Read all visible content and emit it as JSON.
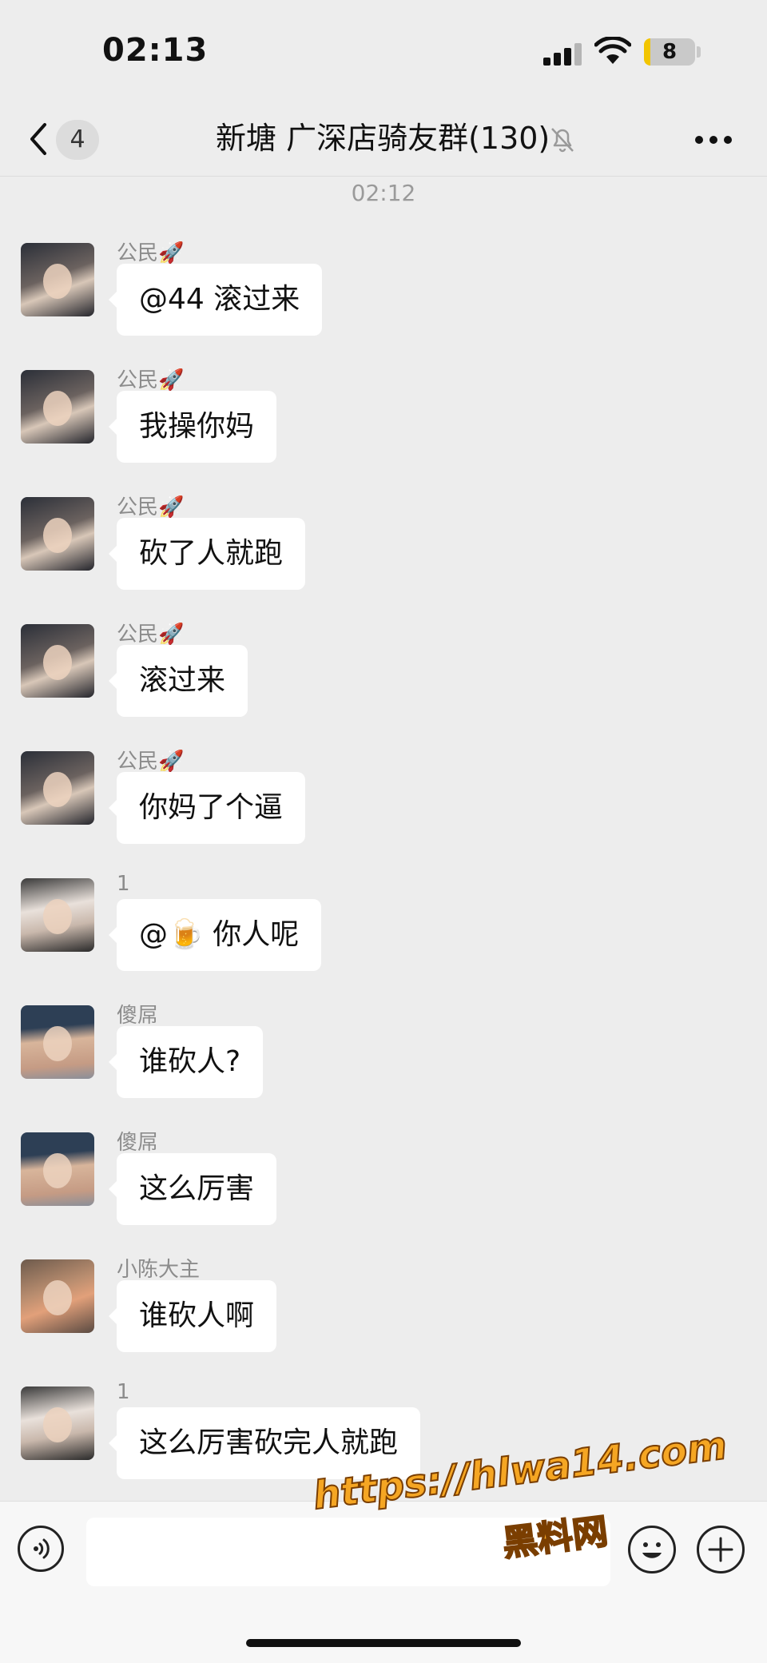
{
  "status_bar": {
    "time": "02:13",
    "battery": "8"
  },
  "header": {
    "unread_count": "4",
    "title": "新塘 广深店骑友群(130)"
  },
  "timestamp": "02:12",
  "messages": [
    {
      "sender": "公民🚀",
      "text": "@44 滚过来"
    },
    {
      "sender": "公民🚀",
      "text": "我操你妈"
    },
    {
      "sender": "公民🚀",
      "text": "砍了人就跑"
    },
    {
      "sender": "公民🚀",
      "text": "滚过来"
    },
    {
      "sender": "公民🚀",
      "text": "你妈了个逼"
    },
    {
      "sender": "1",
      "text": "@🍺 你人呢"
    },
    {
      "sender": "傻屌",
      "text": "谁砍人?"
    },
    {
      "sender": "傻屌",
      "text": "这么厉害"
    },
    {
      "sender": "小陈大主",
      "text": "谁砍人啊"
    },
    {
      "sender": "1",
      "text": "这么厉害砍完人就跑"
    }
  ],
  "watermark": {
    "url": "https://hlwa14.com",
    "name": "黑料网"
  },
  "icons": {
    "back": "chevron-left-icon",
    "mute": "bell-slash-icon",
    "more": "ellipsis-icon",
    "voice": "voice-icon",
    "emoji": "smiley-icon",
    "plus": "plus-icon"
  }
}
